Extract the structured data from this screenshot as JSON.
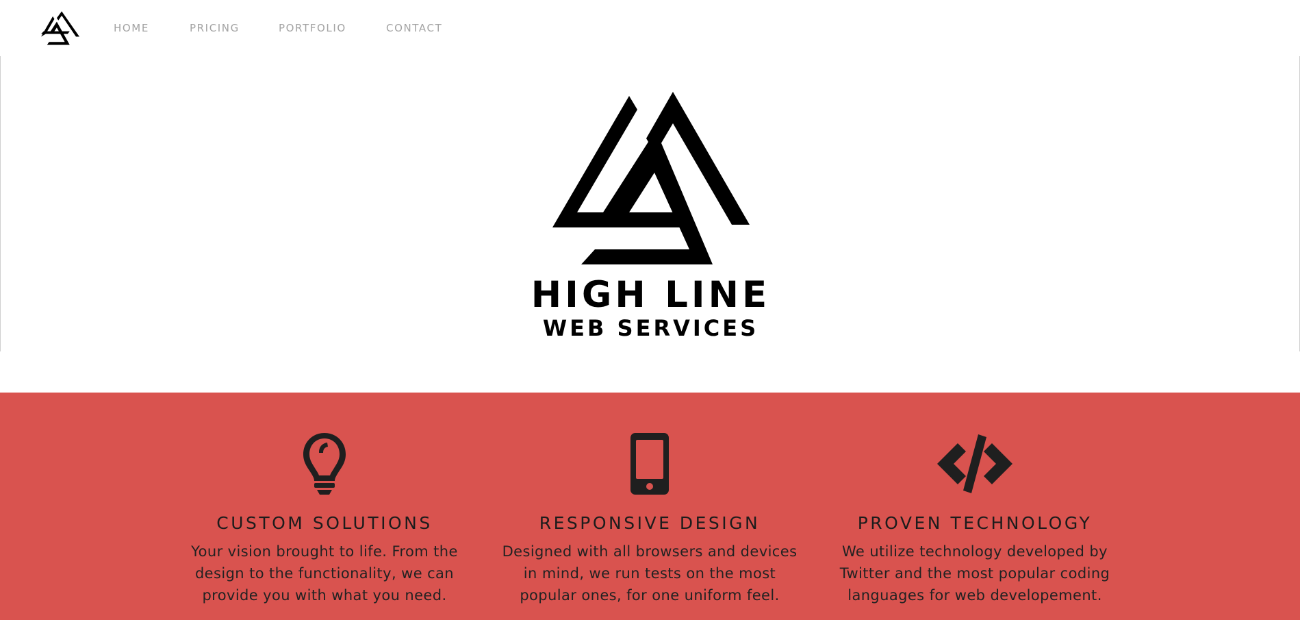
{
  "nav": {
    "logo_icon": "triangle-logo-icon",
    "items": [
      {
        "label": "HOME"
      },
      {
        "label": "PRICING"
      },
      {
        "label": "PORTFOLIO"
      },
      {
        "label": "CONTACT"
      }
    ]
  },
  "hero": {
    "logo_icon": "triangle-logo-icon",
    "title": "HIGH LINE",
    "subtitle": "WEB SERVICES"
  },
  "features": {
    "background_color": "#d9534f",
    "items": [
      {
        "icon": "lightbulb-icon",
        "title": "CUSTOM SOLUTIONS",
        "description": "Your vision brought to life. From the design to the functionality, we can provide you with what you need."
      },
      {
        "icon": "mobile-phone-icon",
        "title": "RESPONSIVE DESIGN",
        "description": "Designed with all browsers and devices in mind, we run tests on the most popular ones, for one uniform feel."
      },
      {
        "icon": "code-icon",
        "title": "PROVEN TECHNOLOGY",
        "description": "We utilize technology developed by Twitter and the most popular coding languages for web developement."
      }
    ]
  }
}
